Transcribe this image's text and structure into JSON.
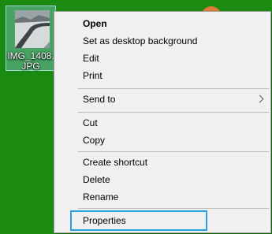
{
  "desktop": {
    "file_icon": {
      "label": "IMG_1408.JPG"
    }
  },
  "context_menu": {
    "items": [
      {
        "label": "Open",
        "bold": true
      },
      {
        "label": "Set as desktop background"
      },
      {
        "label": "Edit"
      },
      {
        "label": "Print"
      },
      {
        "label": "Send to",
        "submenu": true
      },
      {
        "label": "Cut"
      },
      {
        "label": "Copy"
      },
      {
        "label": "Create shortcut"
      },
      {
        "label": "Delete"
      },
      {
        "label": "Rename"
      },
      {
        "label": "Properties",
        "highlighted": true
      }
    ],
    "highlight_color": "#27a3db"
  },
  "colors": {
    "desktop_background": "#1b8a10",
    "menu_background": "#f0f0f0"
  }
}
